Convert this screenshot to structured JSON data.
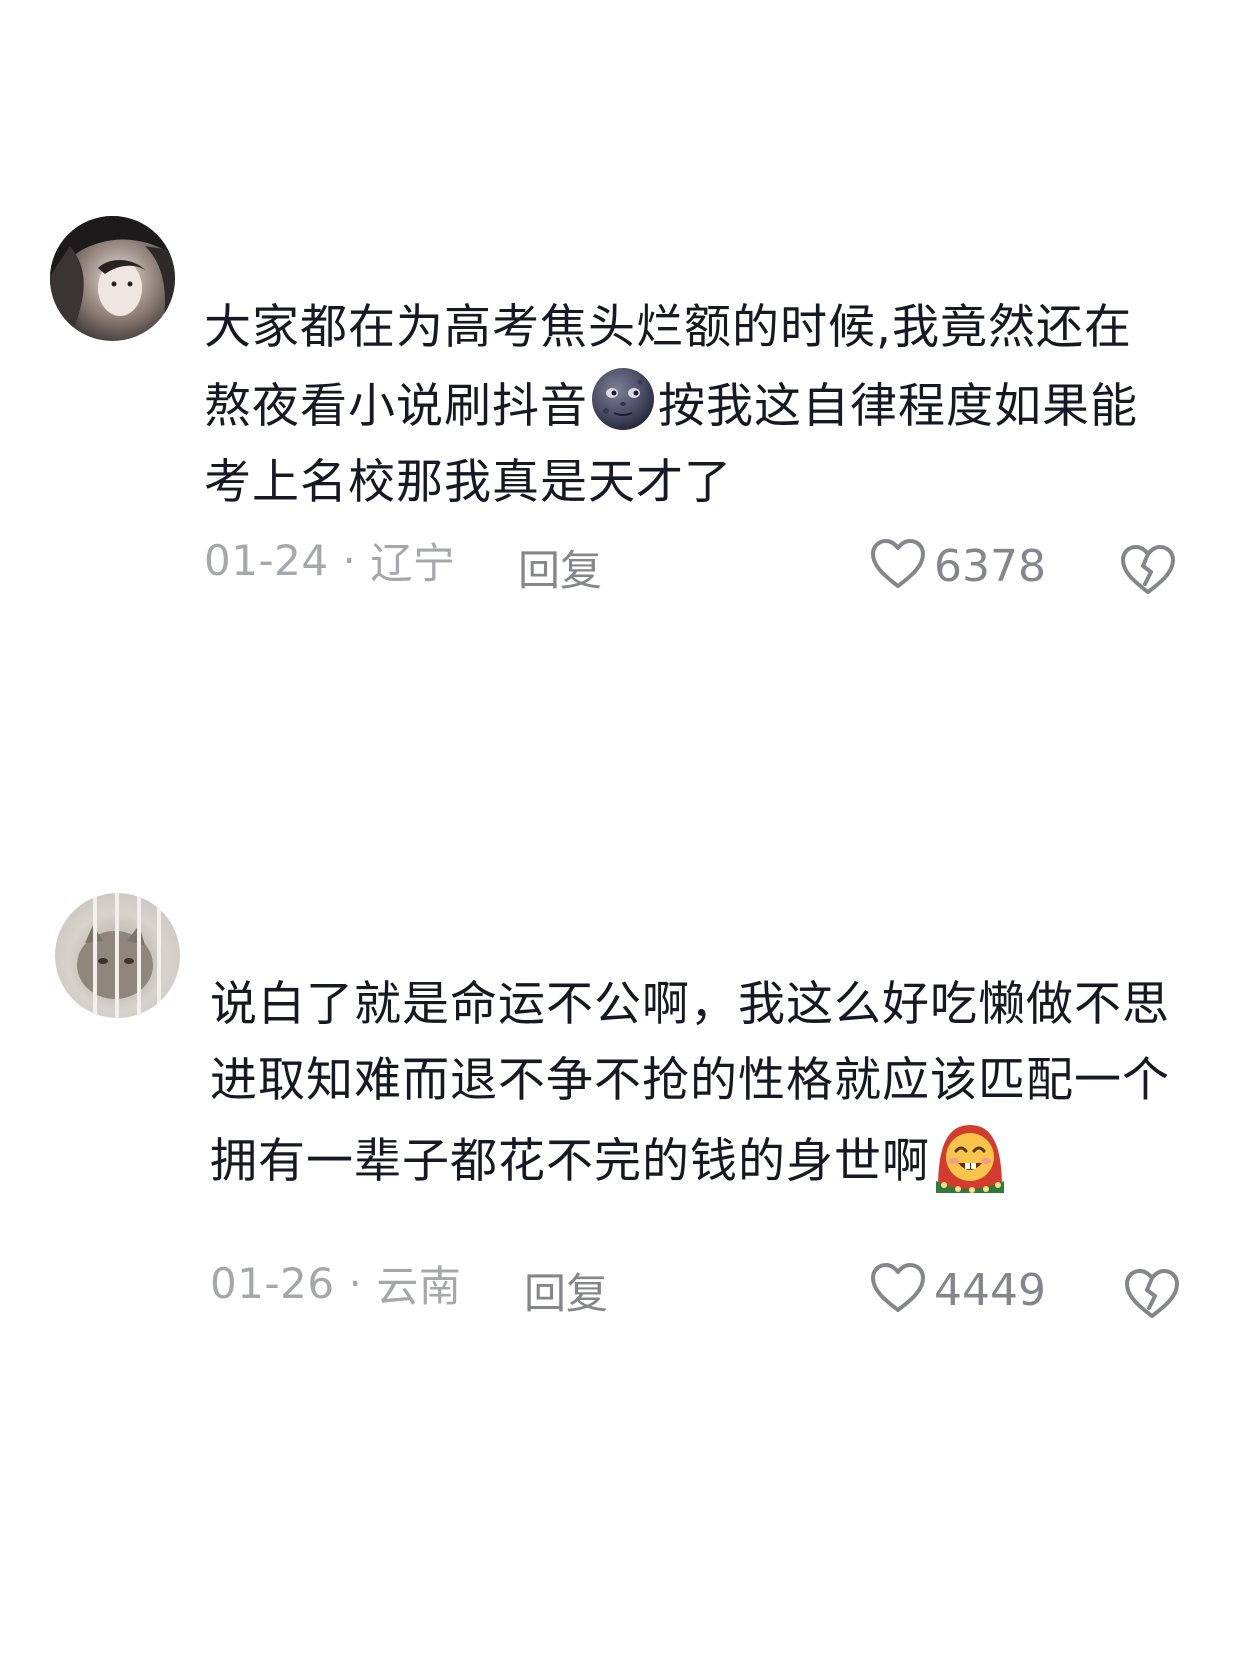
{
  "comments": [
    {
      "text_before_emoji": "大家都在为高考焦头烂额的时候,我竟然还在熬夜看小说刷抖音",
      "emoji": "moon-face-emoji",
      "text_after_emoji": "按我这自律程度如果能考上名校那我真是天才了",
      "date": "01-24",
      "separator": "·",
      "location": "辽宁",
      "reply_label": "回复",
      "like_count": "6378"
    },
    {
      "text_before_emoji": "说白了就是命运不公啊，我这么好吃懒做不思进取知难而退不争不抢的性格就应该匹配一个拥有一辈子都花不完的钱的身世啊",
      "emoji": "grin-flower-hood-emoji",
      "text_after_emoji": "",
      "date": "01-26",
      "separator": "·",
      "location": "云南",
      "reply_label": "回复",
      "like_count": "4449"
    }
  ],
  "colors": {
    "text": "#161823",
    "meta": "#a6a7ab",
    "action": "#85868b"
  }
}
